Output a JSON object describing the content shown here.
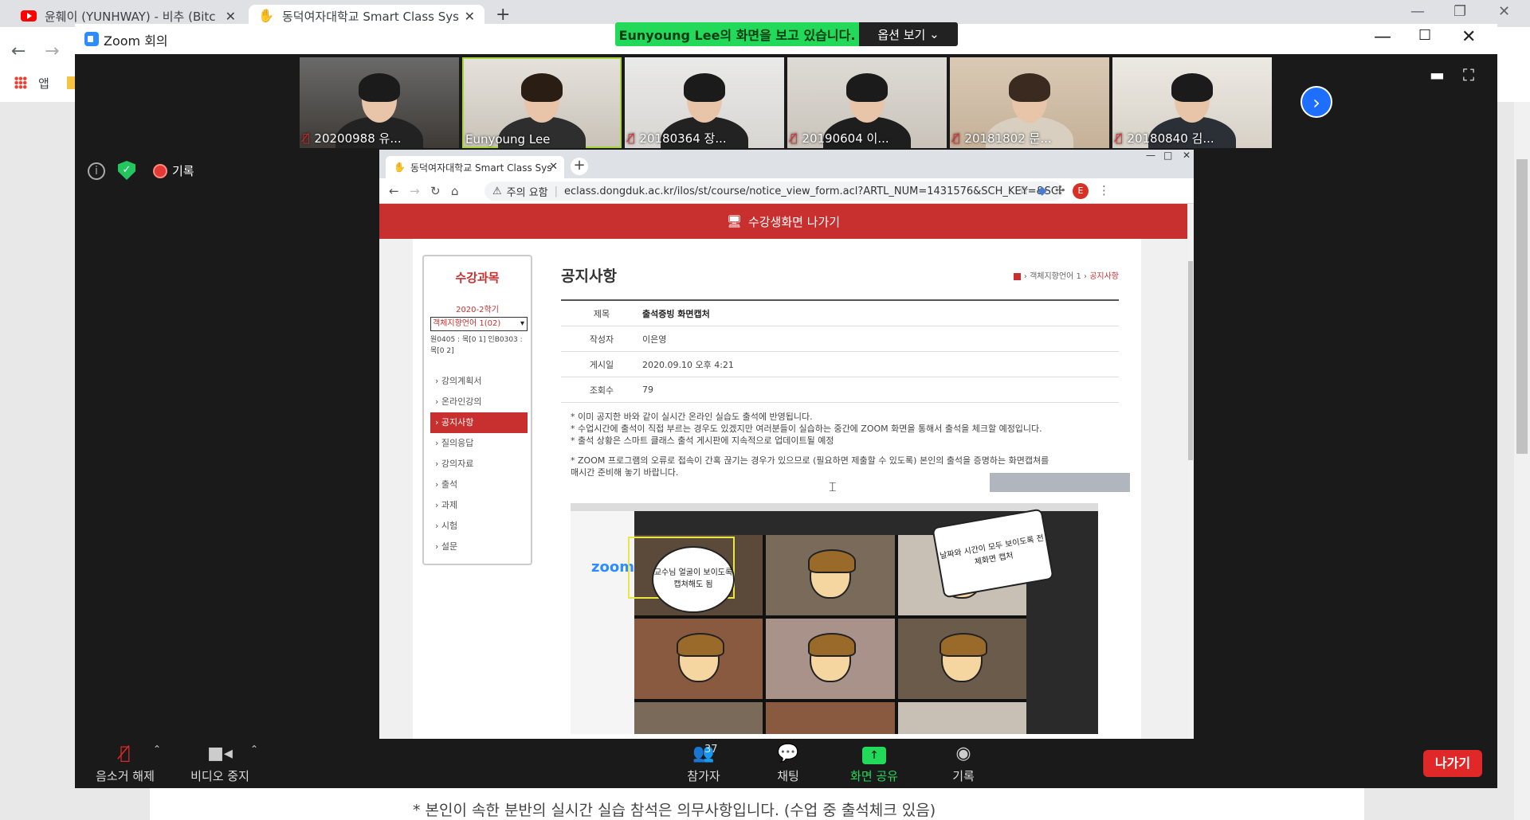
{
  "chrome": {
    "tabs": [
      {
        "label": "윤훼이 (YUNHWAY) - 비추 (Bitc",
        "icon": "youtube-icon"
      },
      {
        "label": "동덕여자대학교 Smart Class Sys",
        "icon": "dongduk-hand-icon"
      }
    ],
    "apps_label": "앱"
  },
  "zoom": {
    "window_title": "Zoom 회의",
    "share_banner": "Eunyoung Lee의 화면을 보고 있습니다.",
    "options_label": "옵션 보기",
    "recording_label": "기록",
    "participants": [
      {
        "name": "20200988 유...",
        "muted": true
      },
      {
        "name": "Eunyoung Lee",
        "muted": false,
        "active": true
      },
      {
        "name": "20180364 장...",
        "muted": true
      },
      {
        "name": "20190604 이...",
        "muted": true
      },
      {
        "name": "20181802 문...",
        "muted": true
      },
      {
        "name": "20180840 김...",
        "muted": true
      }
    ],
    "toolbar": {
      "unmute": "음소거 해제",
      "stop_video": "비디오 중지",
      "participants": "참가자",
      "participant_count": "37",
      "chat": "채팅",
      "share_screen": "화면 공유",
      "record": "기록",
      "leave": "나가기"
    }
  },
  "shared_screen": {
    "tab_title": "동덕여자대학교 Smart Class Sys",
    "url_warning": "주의 요함",
    "url": "eclass.dongduk.ac.kr/ilos/st/course/notice_view_form.acl?ARTL_NUM=1431576&SCH_KEY=&SCH_VA...",
    "avatar_letter": "E",
    "exit_bar": "수강생화면 나가기",
    "sidebar": {
      "title": "수강과목",
      "semester": "2020-2학기",
      "course_select": "객체지향언어 1(02)",
      "room_info": "원0405 : 목[0 1] 인B0303 : 목[0 2]",
      "menu": [
        {
          "label": "강의계획서",
          "active": false
        },
        {
          "label": "온라인강의",
          "active": false
        },
        {
          "label": "공지사항",
          "active": true
        },
        {
          "label": "질의응답",
          "active": false
        },
        {
          "label": "강의자료",
          "active": false
        },
        {
          "label": "출석",
          "active": false
        },
        {
          "label": "과제",
          "active": false
        },
        {
          "label": "시험",
          "active": false
        },
        {
          "label": "설문",
          "active": false
        }
      ]
    },
    "notice": {
      "page_title": "공지사항",
      "breadcrumb": [
        "객체지향언어 1",
        "공지사항"
      ],
      "meta": [
        {
          "key": "제목",
          "value": "출석증빙 화면캡처"
        },
        {
          "key": "작성자",
          "value": "이은영"
        },
        {
          "key": "게시일",
          "value": "2020.09.10 오후 4:21"
        },
        {
          "key": "조회수",
          "value": "79"
        }
      ],
      "body": [
        "* 이미 공지한 바와 같이 실시간 온라인 실습도 출석에 반영됩니다.",
        "* 수업시간에 출석이 직접 부르는 경우도 있겠지만 여러분들이 실습하는 중간에 ZOOM 화면을 통해서 출석을 체크할 예정입니다.",
        "* 출석 상황은 스마트 클래스 출석 게시판에 지속적으로 업데이트될 예정",
        "* ZOOM 프로그램의 오류로 접속이 간혹 끊기는 경우가 있으므로 (필요하면 제출할 수 있도록) 본인의 출석을 증명하는 화면캡쳐를",
        "매시간 준비해 놓기 바랍니다."
      ],
      "image_bubbles": [
        "교수님 얼굴이 보이도록 캡쳐해도 됨",
        "날짜와 시간이 모두 보이도록 전체화면 캡처"
      ]
    }
  },
  "background_page": {
    "notice": "* 본인이 속한 분반의 실시간 실습 참석은 의무사항입니다. (수업 중 출석체크 있음)"
  },
  "colors": {
    "zoom_green": "#23d959",
    "dongduk_red": "#c8302f",
    "leave_red": "#e02828",
    "zoom_blue": "#2d8cff"
  }
}
